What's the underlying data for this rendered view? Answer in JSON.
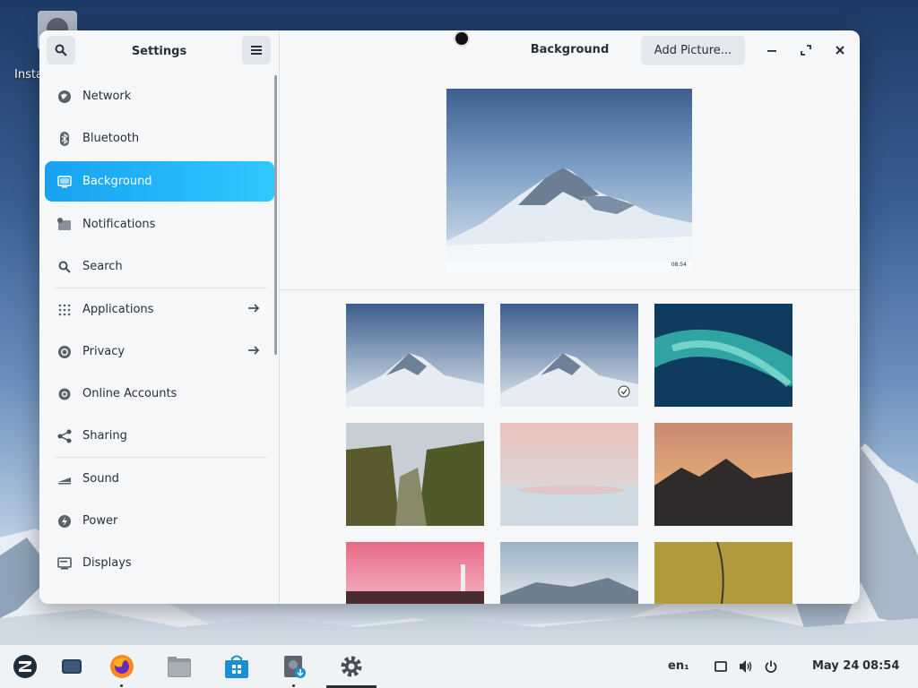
{
  "desktop": {
    "icon_label": "Insta"
  },
  "window": {
    "sidebar_title": "Settings",
    "main_title": "Background",
    "add_picture_label": "Add Picture...",
    "sidebar_items": [
      {
        "label": "Network",
        "icon": "globe-icon",
        "arrow": false,
        "active": false
      },
      {
        "label": "Bluetooth",
        "icon": "bluetooth-icon",
        "arrow": false,
        "active": false
      },
      {
        "label": "Background",
        "icon": "monitor-icon",
        "arrow": false,
        "active": true
      },
      {
        "label": "Notifications",
        "icon": "notifications-icon",
        "arrow": false,
        "active": false
      },
      {
        "label": "Search",
        "icon": "search-icon",
        "arrow": false,
        "active": false
      },
      {
        "label": "Applications",
        "icon": "apps-grid-icon",
        "arrow": true,
        "active": false
      },
      {
        "label": "Privacy",
        "icon": "privacy-icon",
        "arrow": true,
        "active": false
      },
      {
        "label": "Online Accounts",
        "icon": "at-sign-icon",
        "arrow": false,
        "active": false
      },
      {
        "label": "Sharing",
        "icon": "share-icon",
        "arrow": false,
        "active": false
      },
      {
        "label": "Sound",
        "icon": "sound-icon",
        "arrow": false,
        "active": false
      },
      {
        "label": "Power",
        "icon": "power-icon",
        "arrow": false,
        "active": false
      },
      {
        "label": "Displays",
        "icon": "display-icon",
        "arrow": false,
        "active": false
      }
    ],
    "preview_clock": "08:54",
    "wallpapers": [
      {
        "name": "mountain-blue",
        "selected": false
      },
      {
        "name": "mountain-blue-2",
        "selected": true
      },
      {
        "name": "aurora",
        "selected": false
      },
      {
        "name": "canyon",
        "selected": false
      },
      {
        "name": "pink-haze",
        "selected": false
      },
      {
        "name": "sunset-peaks",
        "selected": false
      },
      {
        "name": "lighthouse",
        "selected": false
      },
      {
        "name": "clouds",
        "selected": false
      },
      {
        "name": "golden-field",
        "selected": false
      }
    ]
  },
  "taskbar": {
    "keyboard_layout": "en₁",
    "date": "May 24",
    "time": "08:54",
    "colors": {
      "accent": "#1fb0f5"
    }
  }
}
